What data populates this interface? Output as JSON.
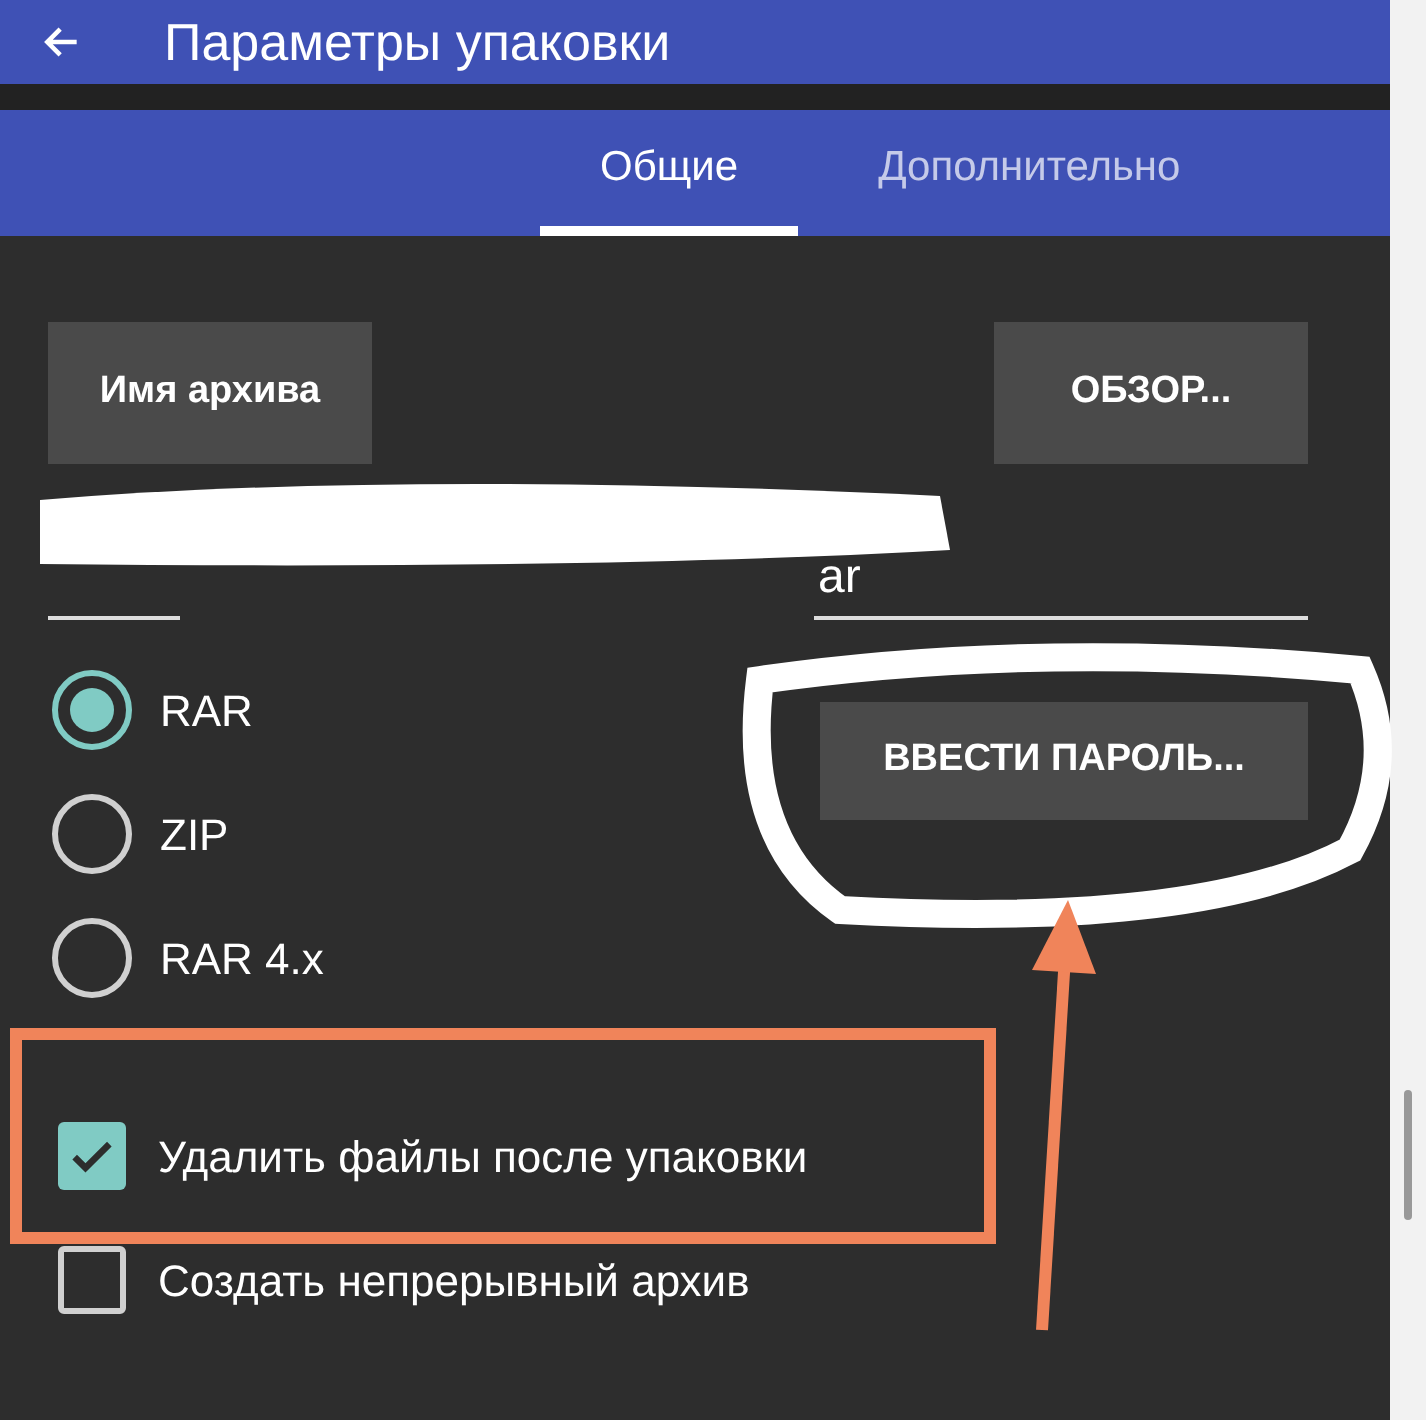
{
  "app_bar": {
    "title": "Параметры упаковки"
  },
  "tabs": [
    {
      "label": "Общие",
      "selected": true
    },
    {
      "label": "Дополнительно",
      "selected": false
    }
  ],
  "archive_name_button": "Имя архива",
  "browse_button": "ОБЗОР...",
  "extension_field": {
    "value": "ar"
  },
  "formats": [
    {
      "label": "RAR",
      "selected": true
    },
    {
      "label": "ZIP",
      "selected": false
    },
    {
      "label": "RAR 4.x",
      "selected": false
    }
  ],
  "password_button": "ВВЕСТИ ПАРОЛЬ...",
  "options": [
    {
      "label": "Удалить файлы после упаковки",
      "checked": true
    },
    {
      "label": "Создать непрерывный архив",
      "checked": false
    }
  ]
}
